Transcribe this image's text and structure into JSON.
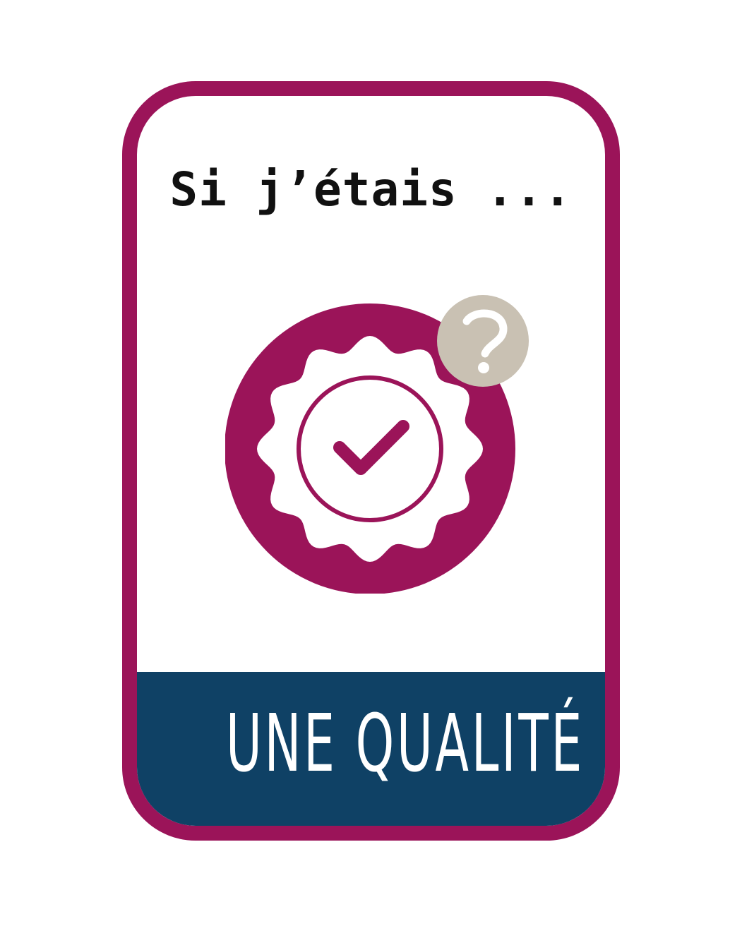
{
  "card": {
    "title": "Si j’étais ...",
    "label": "UNE QUALITÉ"
  },
  "icons": {
    "emblem": "quality-badge-checkmark-icon",
    "badge": "question-mark-icon"
  },
  "colors": {
    "border": "#9b1459",
    "emblem": "#9b1459",
    "band": "#0f4165",
    "question_badge": "#c9c1b3",
    "text": "#111111",
    "label_text": "#ffffff"
  }
}
